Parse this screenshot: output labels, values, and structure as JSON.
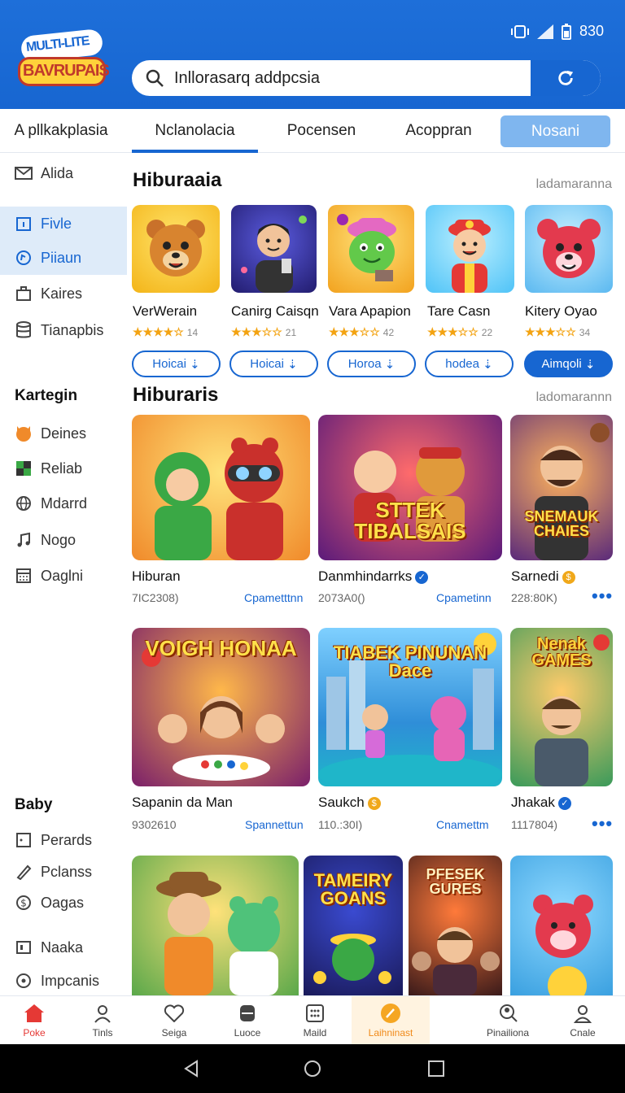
{
  "header": {
    "logo_line1": "MULTI-LITE",
    "logo_line2": "BAVRUPAIS",
    "status_time": "830",
    "search_text": "Inllorasarq addpcsia"
  },
  "tabs": [
    {
      "label": "A pllkakplasia"
    },
    {
      "label": "Nclanolacia"
    },
    {
      "label": "Pocensen"
    },
    {
      "label": "Acoppran"
    },
    {
      "label": "Nosani"
    }
  ],
  "sidebar": {
    "top_items": [
      {
        "label": "Alida",
        "icon": "mail-icon"
      },
      {
        "label": "Fivle",
        "icon": "calendar-icon"
      },
      {
        "label": "Piiaun",
        "icon": "chat-icon"
      },
      {
        "label": "Kaires",
        "icon": "briefcase-icon"
      },
      {
        "label": "Tianapbis",
        "icon": "database-icon"
      }
    ],
    "category_heading": "Kartegin",
    "category_items": [
      {
        "label": "Deines",
        "icon": "fox-icon"
      },
      {
        "label": "Reliab",
        "icon": "puzzle-icon"
      },
      {
        "label": "Mdarrd",
        "icon": "globe-icon"
      },
      {
        "label": "Nogo",
        "icon": "music-icon"
      },
      {
        "label": "Oaglni",
        "icon": "calculator-icon"
      }
    ],
    "baby_heading": "Baby",
    "baby_items": [
      {
        "label": "Perards",
        "icon": "square-icon"
      },
      {
        "label": "Pclanss",
        "icon": "pen-icon"
      },
      {
        "label": "Oagas",
        "icon": "dollar-icon"
      },
      {
        "label": "Naaka",
        "icon": "tablet-icon"
      },
      {
        "label": "Impcanis",
        "icon": "circle-icon"
      }
    ]
  },
  "section1": {
    "title": "Hiburaaia",
    "more": "ladamaranna",
    "apps": [
      {
        "name": "VerWerain",
        "stars": "★★★★☆",
        "count": "14",
        "button": "Hoicai"
      },
      {
        "name": "Canirg Caisqn",
        "stars": "★★★☆☆",
        "count": "21",
        "button": "Hoicai"
      },
      {
        "name": "Vara Apapion",
        "stars": "★★★☆☆",
        "count": "42",
        "button": "Horoa"
      },
      {
        "name": "Tare Casn",
        "stars": "★★★☆☆",
        "count": "22",
        "button": "hodea"
      },
      {
        "name": "Kitery Oyao",
        "stars": "★★★☆☆",
        "count": "34",
        "button": "Aimqoli"
      }
    ]
  },
  "section2": {
    "title": "Hiburaris",
    "more": "ladomarannn",
    "row1": [
      {
        "name": "Hiburan",
        "meta": "7IC2308)",
        "link": "Cpametttnn",
        "overlay": "",
        "badge": ""
      },
      {
        "name": "Danmhindarrks",
        "meta": "2073A0()",
        "link": "Cpametinn",
        "overlay": "STTEK TIBALSAIS",
        "badge": "check"
      },
      {
        "name": "Sarnedi",
        "meta": "228:80K)",
        "link": "",
        "overlay": "SNEMAUK CHAIES",
        "badge": "coin"
      }
    ],
    "row2": [
      {
        "name": "Sapanin da Man",
        "meta": "9302610",
        "link": "Spannettun",
        "overlay": "VOIGH HONAA",
        "badge": ""
      },
      {
        "name": "Saukch",
        "meta": "110.:30I)",
        "link": "Cnamettm",
        "overlay": "TIABEK PINUNAN Dace",
        "badge": "coin"
      },
      {
        "name": "Jhakak",
        "meta": "1117804)",
        "link": "",
        "overlay": "Nenak GAMES",
        "badge": "check"
      }
    ],
    "row3_overlays": [
      "",
      "TAMEIRY GOANS",
      "PFESEK GURES",
      ""
    ]
  },
  "bottom_nav": [
    {
      "label": "Poke",
      "icon": "home-icon"
    },
    {
      "label": "Tinls",
      "icon": "user-icon"
    },
    {
      "label": "Seiga",
      "icon": "heart-icon"
    },
    {
      "label": "Luoce",
      "icon": "database-icon"
    },
    {
      "label": "Maild",
      "icon": "grid-icon"
    },
    {
      "label": "Laihninast",
      "icon": "edit-icon"
    },
    {
      "label": "Pinailiona",
      "icon": "person-search-icon"
    },
    {
      "label": "Cnale",
      "icon": "profile-icon"
    }
  ],
  "colors": {
    "brand_blue": "#1766d1",
    "header_blue": "#1e6fd9",
    "active_red": "#e53935",
    "star": "#f3a312"
  }
}
